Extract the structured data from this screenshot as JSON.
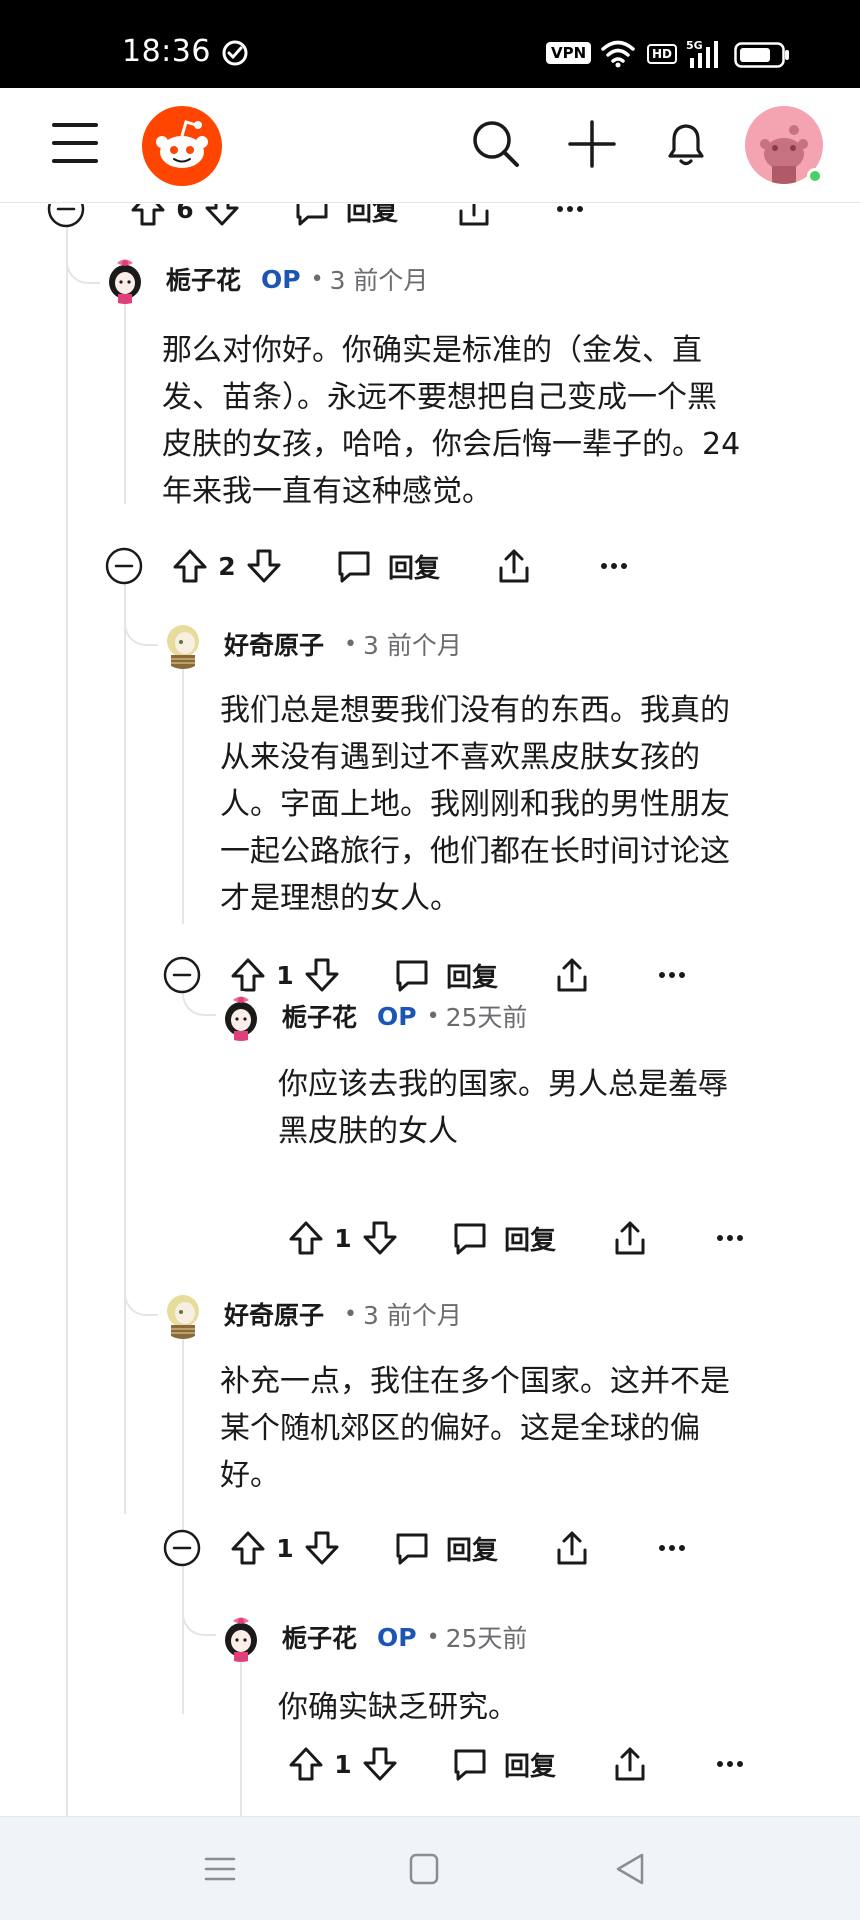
{
  "status_bar": {
    "time": "18:36",
    "vpn": "VPN",
    "hd": "HD",
    "icons": [
      "check-circle-icon",
      "wifi-icon",
      "signal-5g-icon",
      "battery-icon"
    ]
  },
  "header": {
    "icons": [
      "menu-icon",
      "reddit-logo",
      "search-icon",
      "plus-icon",
      "bell-icon",
      "user-avatar"
    ],
    "accent_color": "#ff4500",
    "avatar_color": "#f4a3b0",
    "online_color": "#46d160"
  },
  "partial_action_bar": {
    "votes": "6",
    "reply_label": "回复"
  },
  "comments": [
    {
      "author": "栀子花",
      "op_badge": "OP",
      "dot": "•",
      "time": "3 前个月",
      "lines": [
        "那么对你好。你确实是标准的（金发、直",
        "发、苗条）。永远不要想把自己变成一个黑",
        "皮肤的女孩，哈哈，你会后悔一辈子的。24",
        "年来我一直有这种感觉。"
      ],
      "votes": "2",
      "reply_label": "回复"
    },
    {
      "author": "好奇原子",
      "dot": "•",
      "time": "3 前个月",
      "lines": [
        "我们总是想要我们没有的东西。我真的",
        "从来没有遇到过不喜欢黑皮肤女孩的",
        "人。字面上地。我刚刚和我的男性朋友",
        "一起公路旅行，他们都在长时间讨论这",
        "才是理想的女人。"
      ],
      "votes": "1",
      "reply_label": "回复"
    },
    {
      "author": "栀子花",
      "op_badge": "OP",
      "dot": "•",
      "time": "25天前",
      "lines": [
        "你应该去我的国家。男人总是羞辱",
        "黑皮肤的女人"
      ],
      "votes": "1",
      "reply_label": "回复"
    },
    {
      "author": "好奇原子",
      "dot": "•",
      "time": "3 前个月",
      "lines": [
        "补充一点，我住在多个国家。这并不是",
        "某个随机郊区的偏好。这是全球的偏",
        "好。"
      ],
      "votes": "1",
      "reply_label": "回复"
    },
    {
      "author": "栀子花",
      "op_badge": "OP",
      "dot": "•",
      "time": "25天前",
      "lines": [
        "你确实缺乏研究。"
      ],
      "votes": "1",
      "reply_label": "回复"
    }
  ],
  "colors": {
    "op_badge": "#1b56b5",
    "meta_text": "#6a6c6f",
    "thread_line": "#e3e5e7",
    "nav_background": "#f0f3f8"
  },
  "bottom_nav": {
    "icons": [
      "recent-apps-icon",
      "home-icon",
      "back-icon"
    ]
  }
}
